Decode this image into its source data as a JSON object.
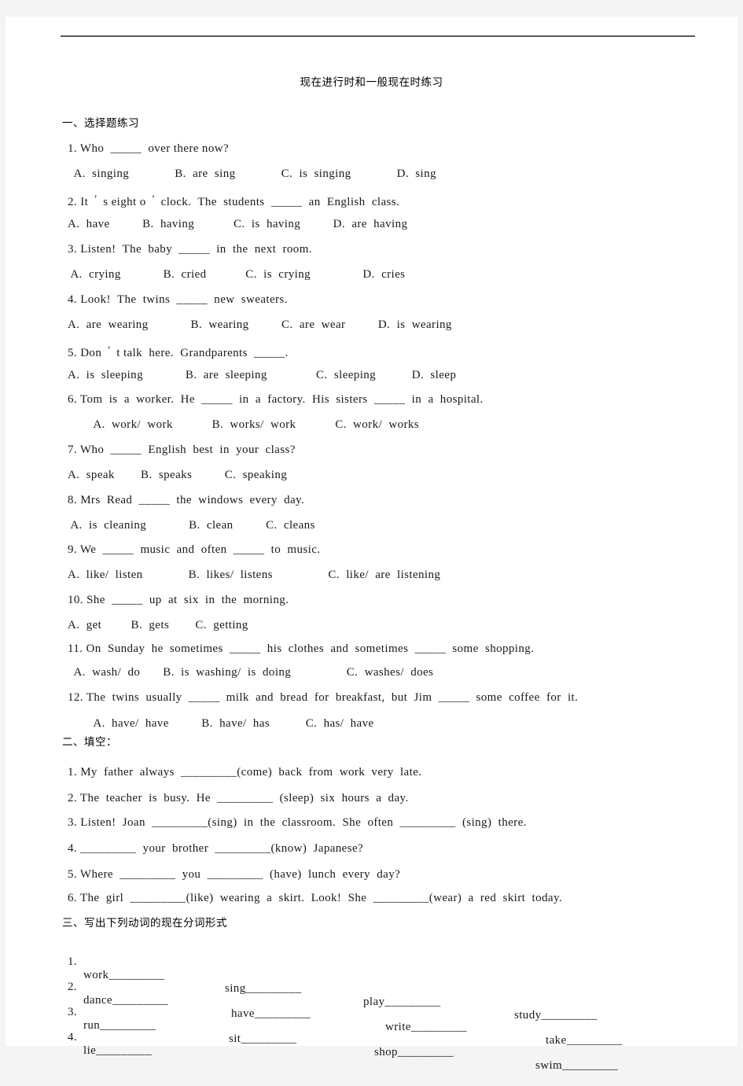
{
  "document": {
    "title": "现在进行时和一般现在时练习",
    "sections": [
      {
        "heading": "一、选择题练习",
        "items": [
          {
            "stem_a": "1. Who  _____  over there now?",
            "stem_b": "",
            "options": "  A.  singing              B.  are  sing              C.  is  singing              D.  sing"
          },
          {
            "stem_a": "2. It ",
            "stem_b": " s eight o ",
            "stem_c": " clock.  The  students  _____  an  English  class.",
            "options": "A.  have          B.  having            C.  is  having          D.  are  having"
          },
          {
            "stem_a": "3. Listen!  The  baby  _____  in  the  next  room.",
            "options": " A.  crying             B.  cried            C.  is  crying                D.  cries"
          },
          {
            "stem_a": "4. Look!  The  twins  _____  new  sweaters.",
            "options": "A.  are  wearing             B.  wearing          C.  are  wear          D.  is  wearing"
          },
          {
            "stem_a": "5. Don ",
            "stem_b": " t talk  here.  Grandparents  _____.",
            "options": "A.  is  sleeping             B.  are  sleeping               C.  sleeping           D.  sleep"
          },
          {
            "stem_a": "6. Tom  is  a  worker.  He  _____  in  a  factory.  His  sisters  _____  in  a  hospital.",
            "options": "        A.  work/  work            B.  works/  work            C.  work/  works"
          },
          {
            "stem_a": "7. Who  _____  English  best  in  your  class?",
            "options": "A.  speak        B.  speaks          C.  speaking"
          },
          {
            "stem_a": "8. Mrs  Read  _____  the  windows  every  day.",
            "options": " A.  is  cleaning             B.  clean          C.  cleans"
          },
          {
            "stem_a": "9. We  _____  music  and  often  _____  to  music.",
            "options": "A.  like/  listen              B.  likes/  listens                 C.  like/  are  listening"
          },
          {
            "stem_a": "10. She  _____  up  at  six  in  the  morning.",
            "options": "A.  get         B.  gets        C.  getting"
          },
          {
            "stem_a": "11. On  Sunday  he  sometimes  _____  his  clothes  and  sometimes  _____  some  shopping.",
            "options": "  A.  wash/  do       B.  is  washing/  is  doing                 C.  washes/  does"
          },
          {
            "stem_a": "12. The  twins  usually  _____  milk  and  bread  for  breakfast,  but  Jim  _____  some  coffee  for  it.",
            "options": "        A.  have/  have          B.  have/  has           C.  has/  have"
          }
        ]
      },
      {
        "heading": "二、填空：",
        "items": [
          {
            "text": "1. My  father  always  _________(come)  back  from  work  very  late."
          },
          {
            "text": "2. The  teacher  is  busy.  He  _________  (sleep)  six  hours  a  day."
          },
          {
            "text": "3. Listen!  Joan  _________(sing)  in  the  classroom.  She  often  _________  (sing)  there."
          },
          {
            "text": "4. _________  your  brother  _________(know)  Japanese?"
          },
          {
            "text": "5. Where  _________  you  _________  (have)  lunch  every  day?"
          },
          {
            "text": "6. The  girl  _________(like)  wearing  a  skirt.  Look!  She  _________(wear)  a  red  skirt  today."
          }
        ]
      },
      {
        "heading": "三、写出下列动词的现在分词形式",
        "rows": [
          {
            "num": "1. ",
            "cells": [
              "work_________",
              "sing_________",
              "play_________",
              "study_________"
            ]
          },
          {
            "num": "2. ",
            "cells": [
              "dance_________",
              "have_________",
              "write_________",
              "take_________"
            ]
          },
          {
            "num": "3. ",
            "cells": [
              "run_________",
              "sit_________",
              "shop_________",
              "swim_________"
            ]
          },
          {
            "num": "4. ",
            "cells": [
              "lie_________",
              "",
              "",
              ""
            ]
          }
        ]
      }
    ]
  },
  "colors": {
    "page_background": "#ffffff",
    "canvas_background": "#f4f4f4",
    "text": "#1a1a1a",
    "rule": "#595959"
  }
}
